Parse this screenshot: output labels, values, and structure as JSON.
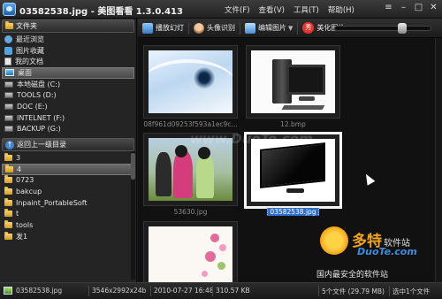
{
  "window": {
    "title": "03582538.jpg - 美图看看 1.3.0.413",
    "menu": [
      "文件(F)",
      "查看(V)",
      "工具(T)",
      "帮助(H)"
    ],
    "buttons": {
      "menu_icon": "≡",
      "minimize": "–",
      "maximize": "□",
      "close": "✕"
    }
  },
  "toolbar": {
    "slideshow": "播放幻灯",
    "face": "头像识别",
    "edit": "编辑图片",
    "beautify": "美化图片",
    "beautify_badge": "秀",
    "zoom_level": 0.72
  },
  "sidebar": {
    "folders_header": "文件夹",
    "quick_items": [
      {
        "label": "最近浏览",
        "icon": "history-icon"
      },
      {
        "label": "图片收藏",
        "icon": "star-icon"
      },
      {
        "label": "我的文档",
        "icon": "document-icon"
      }
    ],
    "desktop": "桌面",
    "drives": [
      "本地磁盘 (C:)",
      "TOOLS (D:)",
      "DOC (E:)",
      "INTELNET (F:)",
      "BACKUP (G:)"
    ],
    "up_label": "返回上一级目录",
    "subfolders": [
      "3",
      "4",
      "0723",
      "bakcup",
      "Inpaint_PortableSoft",
      "t",
      "tools",
      "发1"
    ],
    "selected_subfolder": "4"
  },
  "thumbnails": [
    {
      "name": "08f961d09253f593a1ec9c...",
      "art": "webcam"
    },
    {
      "name": "12.bmp",
      "art": "pc"
    },
    {
      "name": "53630.jpg",
      "art": "girls"
    },
    {
      "name": "03582538.jpg",
      "art": "tv",
      "selected": true
    },
    {
      "name": "",
      "art": "card"
    }
  ],
  "watermark": "www.DuoTe.com",
  "logo": {
    "brand": "多特",
    "sub": "软件站",
    "url": "DuoTe.com",
    "slogan": "国内最安全的软件站"
  },
  "status": {
    "filename": "03582538.jpg",
    "dimensions": "3546x2992x24b",
    "datetime": "2010-07-27 16:48",
    "size": "310.57 KB",
    "count": "5个文件 (29.79 MB)",
    "selection": "选中1个文件"
  }
}
